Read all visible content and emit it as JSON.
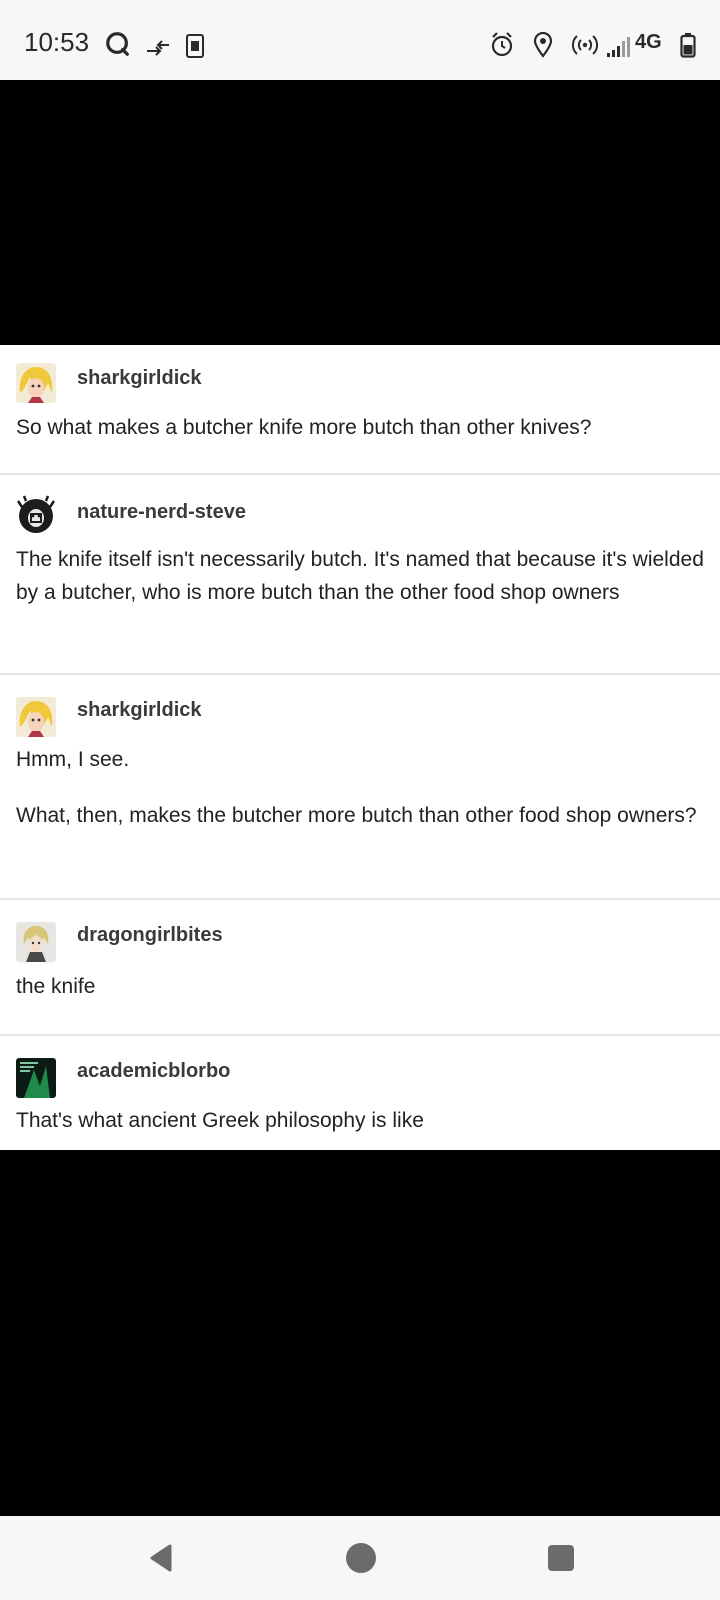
{
  "status_bar": {
    "time": "10:53",
    "network": "4G",
    "icons": [
      "search-app-icon",
      "data-transfer-icon",
      "sim-card-icon",
      "alarm-icon",
      "location-icon",
      "hotspot-icon",
      "signal-icon",
      "battery-icon"
    ]
  },
  "post": {
    "entries": [
      {
        "username": "sharkgirldick",
        "paragraphs": [
          "So what makes a butcher knife more butch than other knives?"
        ]
      },
      {
        "username": "nature-nerd-steve",
        "paragraphs": [
          "The knife itself isn't necessarily butch. It's named that because it's wielded by a butcher, who is more butch than the other food shop owners"
        ]
      },
      {
        "username": "sharkgirldick",
        "paragraphs": [
          "Hmm, I see.",
          "What, then, makes the butcher more butch than other food shop owners?"
        ]
      },
      {
        "username": "dragongirlbites",
        "paragraphs": [
          "the knife"
        ]
      },
      {
        "username": "academicblorbo",
        "paragraphs": [
          "That's what ancient Greek philosophy is like"
        ]
      }
    ]
  },
  "nav_bar": {
    "buttons": [
      "back-button",
      "home-button",
      "recents-button"
    ]
  },
  "colors": {
    "status_bar_bg": "#f7f7f9",
    "page_bg": "#000000",
    "post_bg": "#ffffff",
    "divider": "#e4e4e6",
    "text": "#222222"
  }
}
